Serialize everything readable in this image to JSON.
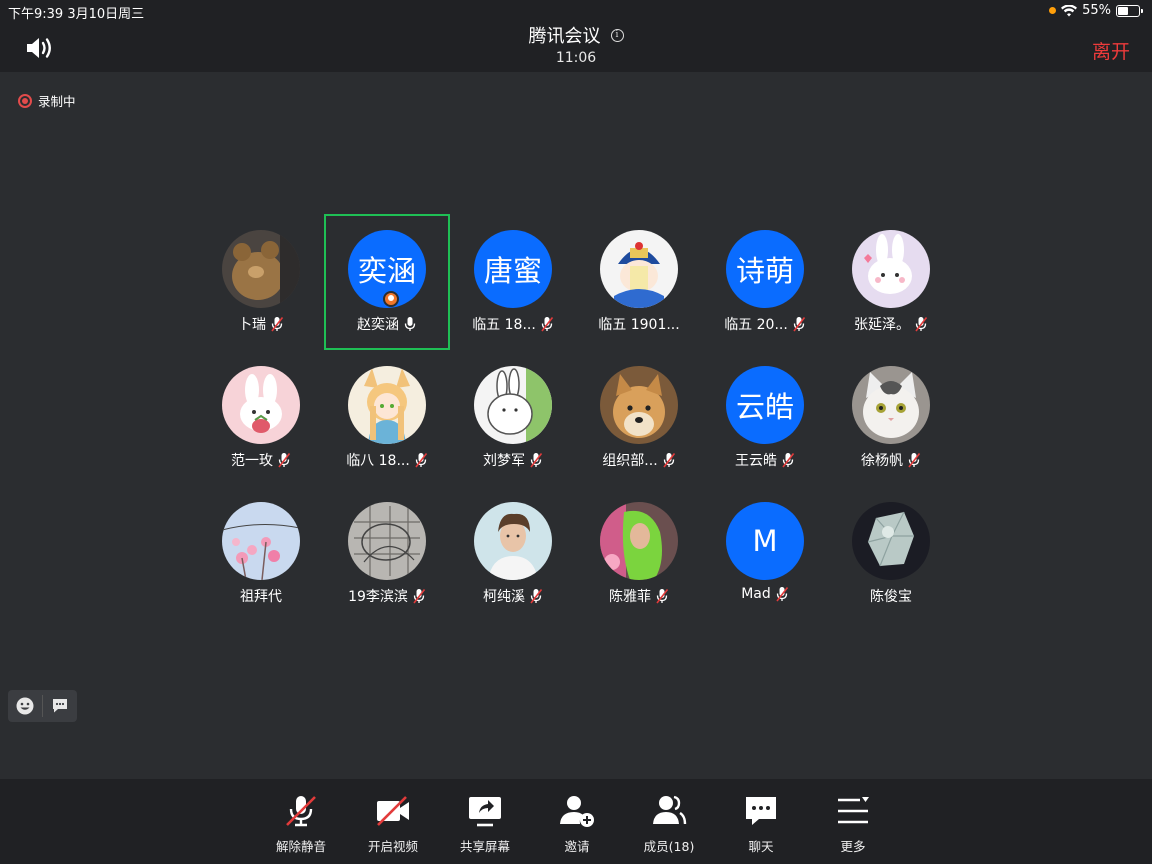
{
  "status": {
    "time_date": "下午9:39   3月10日周三",
    "battery_percent": "55%",
    "battery_level": 0.55
  },
  "header": {
    "title": "腾讯会议",
    "timer": "11:06",
    "leave_label": "离开"
  },
  "recording": {
    "label": "录制中"
  },
  "participants": [
    {
      "name": "卜瑞",
      "avatar_icon": "teddy-bear-photo",
      "mic": "muted"
    },
    {
      "name": "赵奕涵",
      "avatar_text": "奕涵",
      "mic": "on",
      "host": true,
      "active": true
    },
    {
      "name": "临五 18...",
      "avatar_text": "唐蜜",
      "mic": "muted"
    },
    {
      "name": "临五 1901...",
      "avatar_icon": "qing-cartoon-avatar",
      "mic": "none"
    },
    {
      "name": "临五 20...",
      "avatar_text": "诗萌",
      "mic": "muted"
    },
    {
      "name": "张延泽。",
      "avatar_icon": "bunny-cartoon-avatar",
      "mic": "muted"
    },
    {
      "name": "范一玫",
      "avatar_icon": "pink-bunny-avatar",
      "mic": "muted"
    },
    {
      "name": "临八 18...",
      "avatar_icon": "anime-girl-avatar",
      "mic": "muted"
    },
    {
      "name": "刘梦军",
      "avatar_icon": "white-rabbit-avatar",
      "mic": "muted"
    },
    {
      "name": "组织部...",
      "avatar_icon": "doge-avatar",
      "mic": "muted"
    },
    {
      "name": "王云皓",
      "avatar_text": "云皓",
      "mic": "muted"
    },
    {
      "name": "徐杨帆",
      "avatar_icon": "cat-avatar",
      "mic": "muted"
    },
    {
      "name": "祖拜代",
      "avatar_icon": "pink-flowers-avatar",
      "mic": "none"
    },
    {
      "name": "19李滨滨",
      "avatar_icon": "map-sketch-avatar",
      "mic": "muted"
    },
    {
      "name": "柯纯溪",
      "avatar_icon": "portrait-avatar",
      "mic": "muted"
    },
    {
      "name": "陈雅菲",
      "avatar_icon": "green-hair-avatar",
      "mic": "muted"
    },
    {
      "name": "Mad",
      "avatar_text": "M",
      "mic": "muted"
    },
    {
      "name": "陈俊宝",
      "avatar_icon": "crystal-avatar",
      "mic": "none"
    }
  ],
  "toolbar": {
    "unmute": "解除静音",
    "video": "开启视频",
    "share": "共享屏幕",
    "invite": "邀请",
    "members": "成员(18)",
    "chat": "聊天",
    "more": "更多"
  },
  "colors": {
    "accent_blue": "#0a6cff",
    "leave_red": "#ee3b3b",
    "active_green": "#1fbf55",
    "background": "#2b2d30",
    "bar": "#202124"
  }
}
